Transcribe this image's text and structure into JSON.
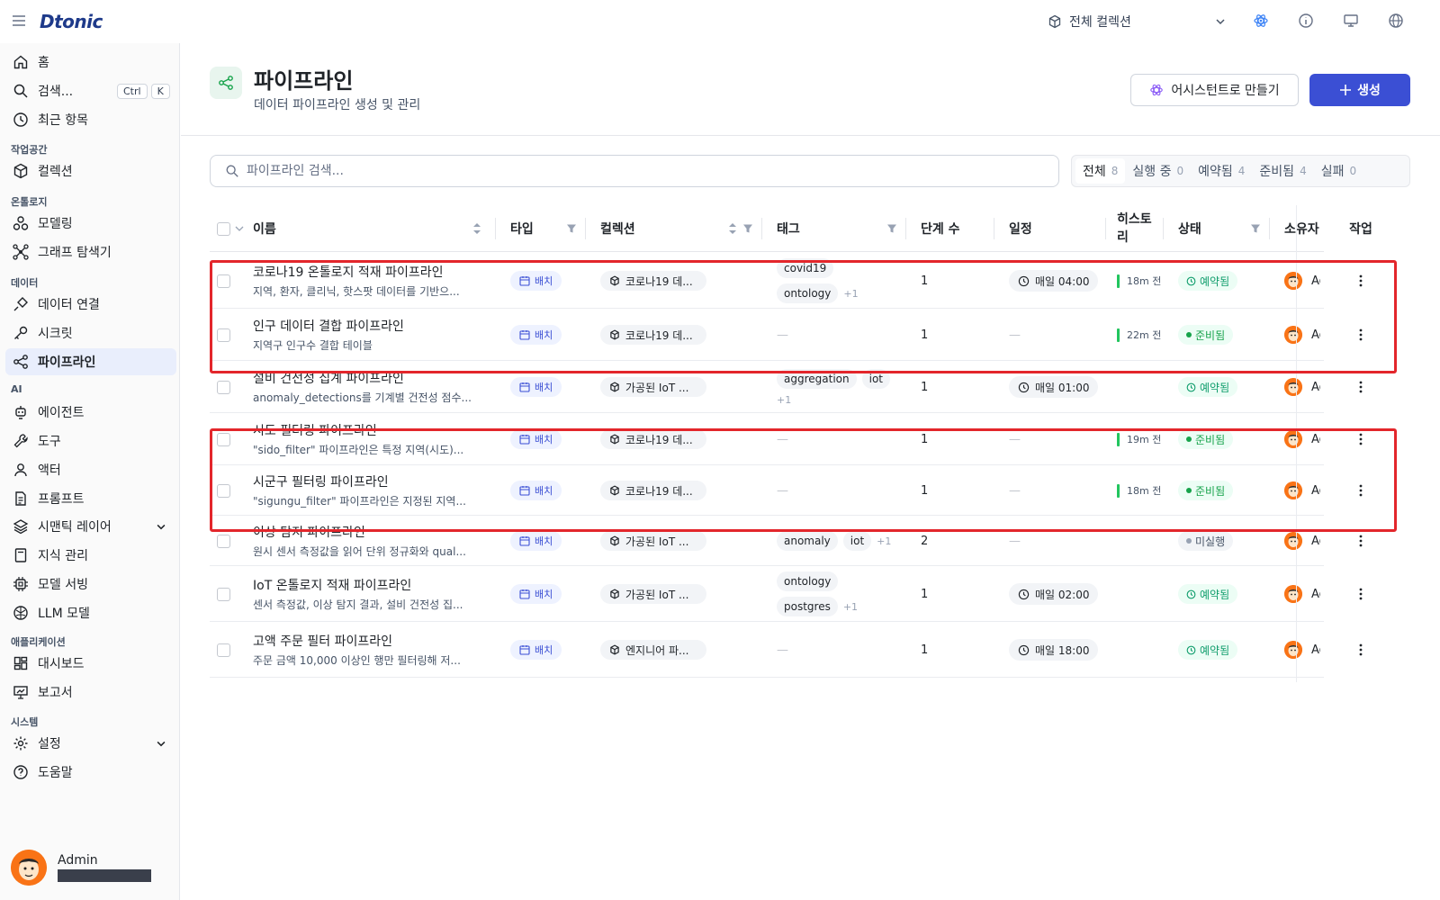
{
  "app": {
    "logo": "Dtonic"
  },
  "topbar": {
    "collection_selector": "전체 컬렉션"
  },
  "sidebar": {
    "home": "홈",
    "search": "검색...",
    "search_kbd": [
      "Ctrl",
      "K"
    ],
    "recent": "최근 항목",
    "sections": {
      "workspace": "작업공간",
      "ontology": "온톨로지",
      "data": "데이터",
      "ai": "AI",
      "apps": "애플리케이션",
      "system": "시스템"
    },
    "items": {
      "collections": "컬렉션",
      "modeling": "모델링",
      "graph_explorer": "그래프 탐색기",
      "data_connection": "데이터 연결",
      "secrets": "시크릿",
      "pipelines": "파이프라인",
      "agents": "에이전트",
      "tools": "도구",
      "actors": "액터",
      "prompts": "프롬프트",
      "semantic_layer": "시맨틱 레이어",
      "knowledge": "지식 관리",
      "model_serving": "모델 서빙",
      "llm_models": "LLM 모델",
      "dashboards": "대시보드",
      "reports": "보고서",
      "settings": "설정",
      "help": "도움말"
    },
    "user": {
      "name": "Admin"
    }
  },
  "page": {
    "title": "파이프라인",
    "subtitle": "데이터 파이프라인 생성 및 관리",
    "assistant_button": "어시스턴트로 만들기",
    "create_button": "생성",
    "search_placeholder": "파이프라인 검색...",
    "filter_tabs": [
      {
        "label": "전체",
        "count": "8"
      },
      {
        "label": "실행 중",
        "count": "0"
      },
      {
        "label": "예약됨",
        "count": "4"
      },
      {
        "label": "준비됨",
        "count": "4"
      },
      {
        "label": "실패",
        "count": "0"
      }
    ]
  },
  "table": {
    "columns": {
      "name": "이름",
      "type": "타입",
      "collection": "컬렉션",
      "tags": "태그",
      "steps": "단계 수",
      "schedule": "일정",
      "history": "히스토리",
      "status": "상태",
      "owner": "소유자",
      "actions": "작업"
    },
    "rows": [
      {
        "name": "코로나19 온톨로지 적재 파이프라인",
        "desc": "지역, 환자, 클리닉, 핫스팟 데이터를 기반으...",
        "type": "배치",
        "collection": "코로나19 데...",
        "tags": [
          "covid19",
          "ontology"
        ],
        "tags_more": "+1",
        "steps": "1",
        "schedule": "매일 04:00",
        "history": "18m 전",
        "status": "예약됨",
        "status_kind": "scheduled",
        "owner": "Admin"
      },
      {
        "name": "인구 데이터 결합 파이프라인",
        "desc": "지역구 인구수 결합 테이블",
        "type": "배치",
        "collection": "코로나19 데...",
        "tags": [],
        "tags_more": "",
        "steps": "1",
        "schedule": "",
        "history": "22m 전",
        "status": "준비됨",
        "status_kind": "ready",
        "owner": "Admin"
      },
      {
        "name": "설비 건전성 집계 파이프라인",
        "desc": "anomaly_detections를 기계별 건전성 점수...",
        "type": "배치",
        "collection": "가공된 IoT ...",
        "tags": [
          "aggregation",
          "iot"
        ],
        "tags_more": "+1",
        "steps": "1",
        "schedule": "매일 01:00",
        "history": "",
        "status": "예약됨",
        "status_kind": "scheduled",
        "owner": "Admin"
      },
      {
        "name": "시도 필터링 파이프라인",
        "desc": "\"sido_filter\" 파이프라인은 특정 지역(시도)...",
        "type": "배치",
        "collection": "코로나19 데...",
        "tags": [],
        "tags_more": "",
        "steps": "1",
        "schedule": "",
        "history": "19m 전",
        "status": "준비됨",
        "status_kind": "ready",
        "owner": "Admin"
      },
      {
        "name": "시군구 필터링 파이프라인",
        "desc": "\"sigungu_filter\" 파이프라인은 지정된 지역...",
        "type": "배치",
        "collection": "코로나19 데...",
        "tags": [],
        "tags_more": "",
        "steps": "1",
        "schedule": "",
        "history": "18m 전",
        "status": "준비됨",
        "status_kind": "ready",
        "owner": "Admin"
      },
      {
        "name": "이상 탐지 파이프라인",
        "desc": "원시 센서 측정값을 읽어 단위 정규화와 qual...",
        "type": "배치",
        "collection": "가공된 IoT ...",
        "tags": [
          "anomaly",
          "iot"
        ],
        "tags_more": "+1",
        "steps": "2",
        "schedule": "",
        "history": "",
        "status": "미실행",
        "status_kind": "notrun",
        "owner": "Admin"
      },
      {
        "name": "IoT 온톨로지 적재 파이프라인",
        "desc": "센서 측정값, 이상 탐지 결과, 설비 건전성 집...",
        "type": "배치",
        "collection": "가공된 IoT ...",
        "tags": [
          "ontology",
          "postgres"
        ],
        "tags_more": "+1",
        "steps": "1",
        "schedule": "매일 02:00",
        "history": "",
        "status": "예약됨",
        "status_kind": "scheduled",
        "owner": "Admin"
      },
      {
        "name": "고액 주문 필터 파이프라인",
        "desc": "주문 금액 10,000 이상인 행만 필터링해 저...",
        "type": "배치",
        "collection": "엔지니어 파...",
        "tags": [],
        "tags_more": "",
        "steps": "1",
        "schedule": "매일 18:00",
        "history": "",
        "status": "예약됨",
        "status_kind": "scheduled",
        "owner": "Admin"
      }
    ]
  },
  "empty_dash": "—",
  "colors": {
    "primary": "#3b4fd4",
    "highlight": "#e3262b",
    "success": "#22c55e"
  }
}
